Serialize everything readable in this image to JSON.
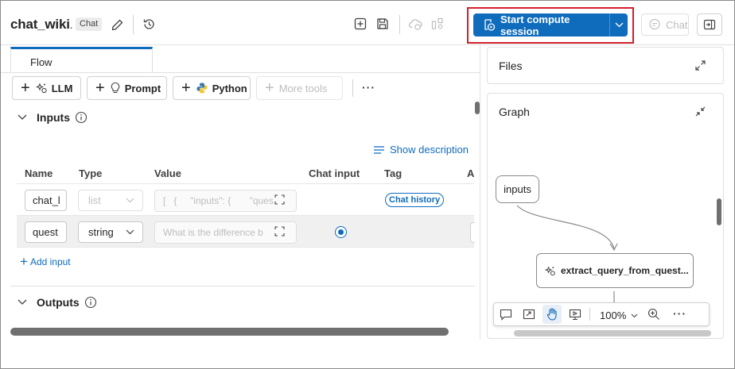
{
  "header": {
    "title": "chat_wiki",
    "title_suffix": ".",
    "badge": "Chat",
    "primary_action": "Start compute session",
    "chat_label": "Chat"
  },
  "tabs": [
    {
      "label": "Flow",
      "active": true
    }
  ],
  "toolbar": {
    "llm": "LLM",
    "prompt": "Prompt",
    "python": "Python",
    "more_tools": "More tools",
    "overflow": "···"
  },
  "inputs": {
    "title": "Inputs",
    "show_description": "Show description",
    "columns": [
      "Name",
      "Type",
      "Value",
      "Chat input",
      "Tag",
      "A"
    ],
    "rows": [
      {
        "name": "chat_l",
        "type": "list",
        "value": "[   {     \"inputs\": {       \"ques",
        "chat_input": false,
        "tag": "Chat history"
      },
      {
        "name": "quest",
        "type": "string",
        "value": "What is the difference b",
        "chat_input": true,
        "tag": ""
      }
    ],
    "add_input": "Add input"
  },
  "outputs": {
    "title": "Outputs"
  },
  "files_panel": {
    "title": "Files"
  },
  "graph_panel": {
    "title": "Graph",
    "nodes": [
      "inputs",
      "extract_query_from_quest..."
    ],
    "zoom": "100%"
  },
  "colors": {
    "primary": "#0f6cbd",
    "highlight": "#d21f2b",
    "selection_row": "#f0f0f0"
  }
}
